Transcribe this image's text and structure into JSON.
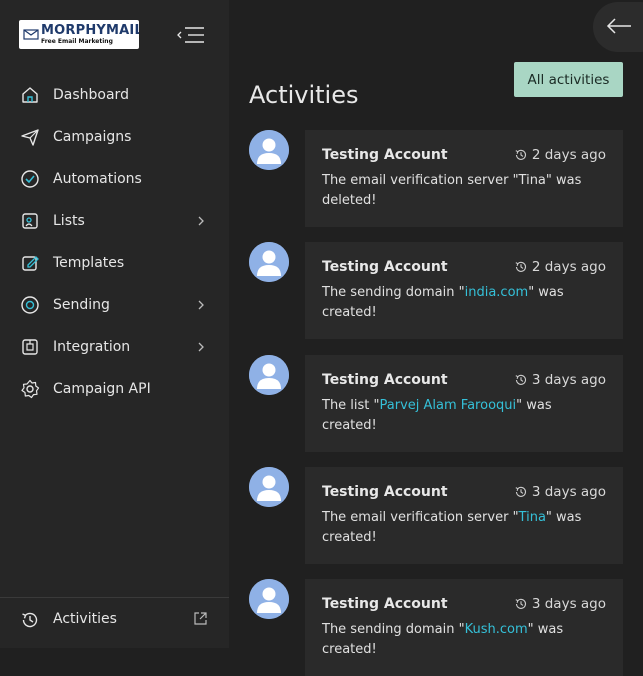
{
  "sidebar": {
    "logo": {
      "name": "MORPHYMAIL",
      "tagline": "Free Email Marketing"
    },
    "items": [
      {
        "label": "Dashboard",
        "icon": "home-icon",
        "has_submenu": false
      },
      {
        "label": "Campaigns",
        "icon": "send-icon",
        "has_submenu": false
      },
      {
        "label": "Automations",
        "icon": "check-shield-icon",
        "has_submenu": false
      },
      {
        "label": "Lists",
        "icon": "list-icon",
        "has_submenu": true
      },
      {
        "label": "Templates",
        "icon": "edit-icon",
        "has_submenu": false
      },
      {
        "label": "Sending",
        "icon": "sending-icon",
        "has_submenu": true
      },
      {
        "label": "Integration",
        "icon": "integration-icon",
        "has_submenu": true
      },
      {
        "label": "Campaign API",
        "icon": "gear-icon",
        "has_submenu": false
      }
    ],
    "footer": {
      "label": "Activities",
      "icon": "history-icon"
    }
  },
  "header": {
    "back_icon": "arrow-left-icon"
  },
  "main": {
    "title": "Activities",
    "all_button": "All activities",
    "activities": [
      {
        "user": "Testing Account",
        "time": "2 days ago",
        "pre": "The email verification server \"Tina\" was deleted!",
        "link": "",
        "post": ""
      },
      {
        "user": "Testing Account",
        "time": "2 days ago",
        "pre": "The sending domain \"",
        "link": "india.com",
        "post": "\" was created!"
      },
      {
        "user": "Testing Account",
        "time": "3 days ago",
        "pre": "The list \"",
        "link": "Parvej Alam Farooqui",
        "post": "\" was created!"
      },
      {
        "user": "Testing Account",
        "time": "3 days ago",
        "pre": "The email verification server \"",
        "link": "Tina",
        "post": "\" was created!"
      },
      {
        "user": "Testing Account",
        "time": "3 days ago",
        "pre": "The sending domain \"",
        "link": "Kush.com",
        "post": "\" was created!"
      }
    ]
  },
  "colors": {
    "accent": "#a9d6c4",
    "link": "#35c0d8",
    "background": "#202020",
    "sidebar": "#262626",
    "card": "#2a2a2a"
  }
}
